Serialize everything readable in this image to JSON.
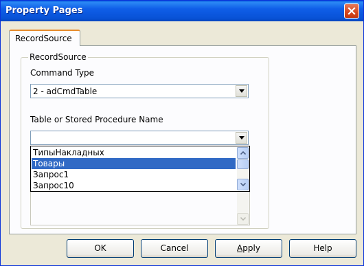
{
  "window": {
    "title": "Property Pages"
  },
  "tabs": [
    {
      "label": "RecordSource"
    }
  ],
  "group": {
    "legend": "RecordSource",
    "command_type": {
      "label": "Command Type",
      "value": "2 - adCmdTable"
    },
    "table_name": {
      "label": "Table or Stored Procedure Name",
      "value": "",
      "options": [
        "ТипыНакладных",
        "Товары",
        "Запрос1",
        "Запрос10"
      ],
      "selected": "Товары"
    }
  },
  "buttons": {
    "ok": "OK",
    "cancel": "Cancel",
    "apply_prefix": "",
    "apply_accel": "A",
    "apply_rest": "pply",
    "help": "Help"
  },
  "icons": {
    "close": "close-icon",
    "combo_arrow": "chevron-down-icon",
    "scroll_up": "chevron-up-icon",
    "scroll_down": "chevron-down-icon"
  },
  "colors": {
    "titlebar": "#0852d6",
    "selection": "#316ac5",
    "window_bg": "#ece9d8"
  }
}
